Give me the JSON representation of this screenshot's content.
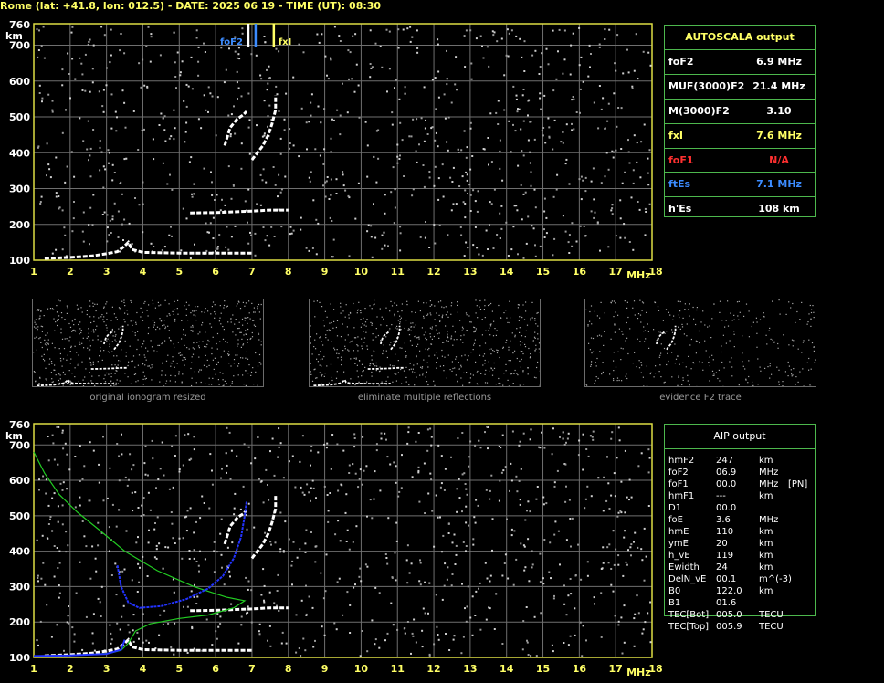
{
  "header": {
    "title": "Rome (lat: +41.8, lon: 012.5) - DATE: 2025 06 19 - TIME (UT): 08:30"
  },
  "autoscala": {
    "title": "AUTOSCALA output",
    "rows": [
      {
        "label": "foF2",
        "value": "6.9 MHz",
        "color": "#ffffff"
      },
      {
        "label": "MUF(3000)F2",
        "value": "21.4 MHz",
        "color": "#ffffff"
      },
      {
        "label": "M(3000)F2",
        "value": "3.10",
        "color": "#ffffff"
      },
      {
        "label": "fxI",
        "value": "7.6 MHz",
        "color": "#ffff66"
      },
      {
        "label": "foF1",
        "value": "N/A",
        "color": "#ff3030"
      },
      {
        "label": "ftEs",
        "value": "7.1 MHz",
        "color": "#3c8cff"
      },
      {
        "label": "h'Es",
        "value": "108 km",
        "color": "#ffffff"
      }
    ]
  },
  "aip": {
    "title": "AIP output",
    "rows": [
      {
        "name": "hmF2",
        "value": "247",
        "unit": "km",
        "extra": ""
      },
      {
        "name": "foF2",
        "value": "06.9",
        "unit": "MHz",
        "extra": ""
      },
      {
        "name": "foF1",
        "value": "00.0",
        "unit": "MHz",
        "extra": "[PN]"
      },
      {
        "name": "hmF1",
        "value": "---",
        "unit": "km",
        "extra": ""
      },
      {
        "name": "D1",
        "value": "00.0",
        "unit": "",
        "extra": ""
      },
      {
        "name": "foE",
        "value": "3.6",
        "unit": "MHz",
        "extra": ""
      },
      {
        "name": "hmE",
        "value": "110",
        "unit": "km",
        "extra": ""
      },
      {
        "name": "ymE",
        "value": "20",
        "unit": "km",
        "extra": ""
      },
      {
        "name": "h_vE",
        "value": "119",
        "unit": "km",
        "extra": ""
      },
      {
        "name": "Ewidth",
        "value": "24",
        "unit": "km",
        "extra": ""
      },
      {
        "name": "DelN_vE",
        "value": "00.1",
        "unit": "m^(-3)",
        "extra": ""
      },
      {
        "name": "B0",
        "value": "122.0",
        "unit": "km",
        "extra": ""
      },
      {
        "name": "B1",
        "value": "01.6",
        "unit": "",
        "extra": ""
      },
      {
        "name": "TEC[Bot]",
        "value": "005.0",
        "unit": "TECU",
        "extra": ""
      },
      {
        "name": "TEC[Top]",
        "value": "005.9",
        "unit": "TECU",
        "extra": ""
      }
    ]
  },
  "thumbnails": [
    {
      "caption": "original ionogram resized"
    },
    {
      "caption": "eliminate multiple reflections"
    },
    {
      "caption": "evidence F2 trace"
    }
  ],
  "chart_data": [
    {
      "type": "scatter",
      "name_note": "top ionogram",
      "x_ticks": [
        "1",
        "2",
        "3",
        "4",
        "5",
        "6",
        "7",
        "8",
        "9",
        "10",
        "11",
        "12",
        "13",
        "14",
        "15",
        "16",
        "17",
        "18"
      ],
      "xunit": "MHz",
      "y_ticks": [
        "100",
        "200",
        "300",
        "400",
        "500",
        "600",
        "700"
      ],
      "ytop": "760",
      "yunit": "km",
      "xlim": [
        1,
        18
      ],
      "ylim": [
        100,
        760
      ],
      "markers": [
        {
          "label": "foF2",
          "x": 6.9,
          "color": "#ffffff"
        },
        {
          "label": "ftEs",
          "x": 7.1,
          "color": "#3c8cff"
        },
        {
          "label": "fxI",
          "x": 7.6,
          "color": "#ffff66"
        }
      ],
      "traces": {
        "E_layer": [
          [
            1.3,
            105
          ],
          [
            2,
            108
          ],
          [
            2.6,
            112
          ],
          [
            3.0,
            118
          ],
          [
            3.3,
            124
          ],
          [
            3.5,
            140
          ],
          [
            3.6,
            150
          ],
          [
            3.7,
            130
          ],
          [
            4,
            122
          ],
          [
            5,
            120
          ],
          [
            6,
            120
          ],
          [
            7,
            120
          ]
        ],
        "Es_layer": [
          [
            5.3,
            232
          ],
          [
            6.0,
            233
          ],
          [
            6.5,
            235
          ],
          [
            7.0,
            237
          ],
          [
            7.5,
            240
          ],
          [
            8.0,
            240
          ]
        ],
        "F2_o": [
          [
            6.25,
            420
          ],
          [
            6.4,
            470
          ],
          [
            6.6,
            495
          ],
          [
            6.75,
            505
          ],
          [
            6.85,
            515
          ]
        ],
        "F2_x": [
          [
            7.0,
            380
          ],
          [
            7.15,
            400
          ],
          [
            7.3,
            420
          ],
          [
            7.45,
            450
          ],
          [
            7.55,
            480
          ],
          [
            7.65,
            520
          ],
          [
            7.65,
            560
          ]
        ]
      }
    },
    {
      "type": "scatter",
      "name_note": "bottom ionogram with AIP profile",
      "x_ticks": [
        "1",
        "2",
        "3",
        "4",
        "5",
        "6",
        "7",
        "8",
        "9",
        "10",
        "11",
        "12",
        "13",
        "14",
        "15",
        "16",
        "17",
        "18"
      ],
      "xunit": "MHz",
      "y_ticks": [
        "100",
        "200",
        "300",
        "400",
        "500",
        "600",
        "700"
      ],
      "ytop": "760",
      "yunit": "km",
      "xlim": [
        1,
        18
      ],
      "ylim": [
        100,
        760
      ],
      "profile_green": [
        [
          1.0,
          680
        ],
        [
          1.3,
          620
        ],
        [
          1.7,
          560
        ],
        [
          2.2,
          510
        ],
        [
          2.8,
          460
        ],
        [
          3.5,
          400
        ],
        [
          4.4,
          345
        ],
        [
          5.4,
          300
        ],
        [
          6.3,
          270
        ],
        [
          6.8,
          260
        ],
        [
          6.5,
          240
        ],
        [
          5.8,
          220
        ],
        [
          5.0,
          210
        ],
        [
          4.2,
          195
        ],
        [
          3.8,
          175
        ],
        [
          3.6,
          140
        ],
        [
          3.4,
          120
        ],
        [
          3.1,
          112
        ],
        [
          2.5,
          108
        ],
        [
          2,
          106
        ],
        [
          1,
          104
        ]
      ],
      "profile_blue": [
        [
          3.3,
          360
        ],
        [
          3.4,
          300
        ],
        [
          3.6,
          255
        ],
        [
          3.9,
          240
        ],
        [
          4.5,
          245
        ],
        [
          5.2,
          265
        ],
        [
          5.8,
          295
        ],
        [
          6.2,
          330
        ],
        [
          6.5,
          380
        ],
        [
          6.7,
          440
        ],
        [
          6.8,
          500
        ],
        [
          6.85,
          540
        ]
      ],
      "blue_E": [
        [
          1.0,
          104
        ],
        [
          2.0,
          106
        ],
        [
          3.0,
          110
        ],
        [
          3.4,
          122
        ],
        [
          3.5,
          150
        ]
      ]
    }
  ]
}
